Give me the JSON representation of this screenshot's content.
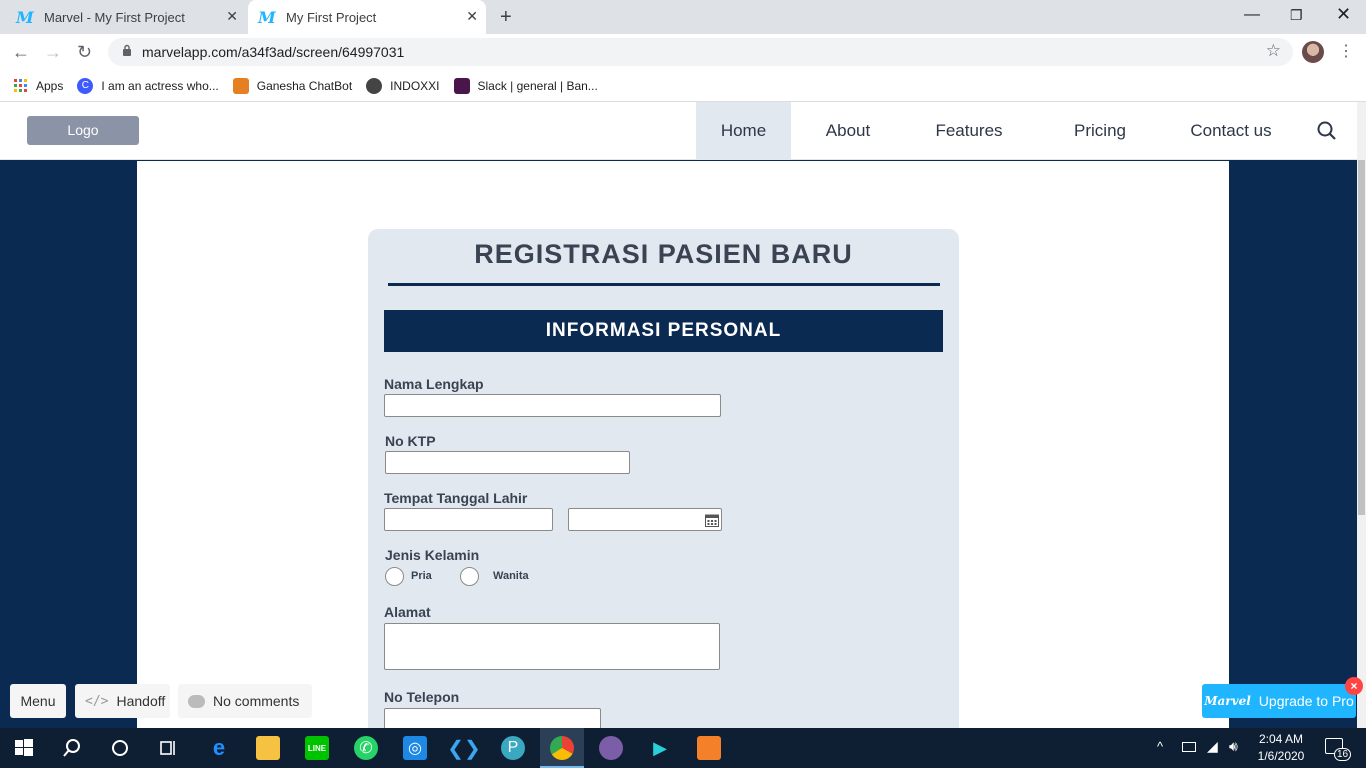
{
  "browser": {
    "tabs": [
      {
        "title": "Marvel - My First Project",
        "active": false
      },
      {
        "title": "My First Project",
        "active": true
      }
    ],
    "url": "marvelapp.com/a34f3ad/screen/64997031",
    "bookmarks": [
      {
        "label": "Apps",
        "icon": "apps-grid-icon",
        "color": "#ea4335"
      },
      {
        "label": "I am an actress who...",
        "icon": "c-icon",
        "color": "#3d5afe"
      },
      {
        "label": "Ganesha ChatBot",
        "icon": "chatbot-icon",
        "color": "#e67e22"
      },
      {
        "label": "INDOXXI",
        "icon": "globe-icon",
        "color": "#444444"
      },
      {
        "label": "Slack | general | Ban...",
        "icon": "slack-icon",
        "color": "#4a154b"
      }
    ]
  },
  "site": {
    "logo": "Logo",
    "nav": [
      "Home",
      "About",
      "Features",
      "Pricing",
      "Contact us"
    ],
    "active_nav": "Home"
  },
  "form": {
    "title": "REGISTRASI PASIEN BARU",
    "section": "INFORMASI PERSONAL",
    "fields": {
      "nama": "Nama Lengkap",
      "ktp": "No KTP",
      "ttl": "Tempat Tanggal Lahir",
      "jk": "Jenis Kelamin",
      "alamat": "Alamat",
      "telepon": "No Telepon"
    },
    "gender_options": [
      "Pria",
      "Wanita"
    ]
  },
  "marvel": {
    "menu": "Menu",
    "handoff": "Handoff",
    "comments": "No comments",
    "upgrade": "Upgrade to Pro",
    "upgrade_brand": "Marvel"
  },
  "taskbar": {
    "time": "2:04 AM",
    "date": "1/6/2020",
    "notifications": "16"
  },
  "colors": {
    "page_bg": "#0a2a52",
    "form_bg": "#e2e8f0",
    "marvel_blue": "#1fb6ff"
  }
}
